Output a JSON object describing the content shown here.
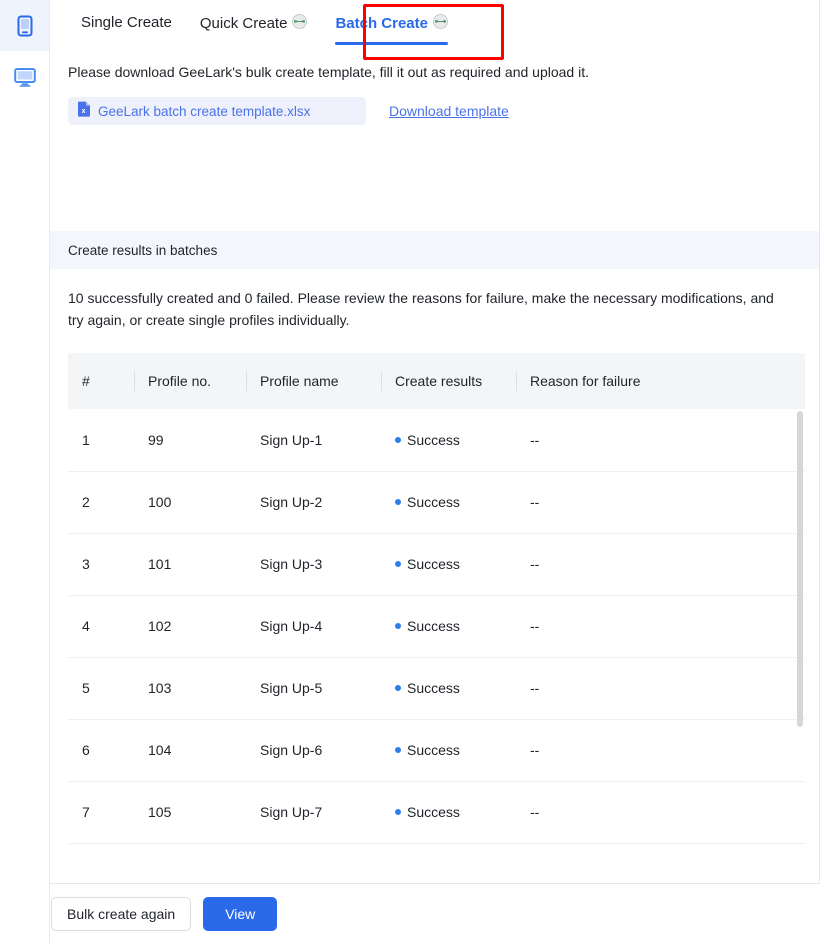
{
  "sidebar": {
    "items": [
      {
        "name": "phone-profiles",
        "icon": "phone-icon",
        "active": true
      },
      {
        "name": "desktop-profiles",
        "icon": "monitor-icon",
        "active": false
      }
    ]
  },
  "tabs": [
    {
      "label": "Single Create",
      "active": false,
      "has_help_badge": false
    },
    {
      "label": "Quick Create",
      "active": false,
      "has_help_badge": true
    },
    {
      "label": "Batch Create",
      "active": true,
      "has_help_badge": true
    }
  ],
  "highlight": {
    "color": "#fe0000",
    "target": "Batch Create"
  },
  "upload": {
    "instruction": "Please download GeeLark's bulk create template, fill it out as required and upload it.",
    "file_name": "GeeLark batch create template.xlsx",
    "file_icon": "xlsx-file-icon",
    "download_link": "Download template"
  },
  "results": {
    "band_title": "Create results in batches",
    "summary": "10 successfully created and 0 failed. Please review the reasons for failure, make the necessary modifications, and try again, or create single profiles individually.",
    "columns": [
      "#",
      "Profile no.",
      "Profile name",
      "Create results",
      "Reason for failure"
    ],
    "rows": [
      {
        "index": "1",
        "profile_no": "99",
        "profile_name": "Sign Up-1",
        "result": "Success",
        "reason": "--"
      },
      {
        "index": "2",
        "profile_no": "100",
        "profile_name": "Sign Up-2",
        "result": "Success",
        "reason": "--"
      },
      {
        "index": "3",
        "profile_no": "101",
        "profile_name": "Sign Up-3",
        "result": "Success",
        "reason": "--"
      },
      {
        "index": "4",
        "profile_no": "102",
        "profile_name": "Sign Up-4",
        "result": "Success",
        "reason": "--"
      },
      {
        "index": "5",
        "profile_no": "103",
        "profile_name": "Sign Up-5",
        "result": "Success",
        "reason": "--"
      },
      {
        "index": "6",
        "profile_no": "104",
        "profile_name": "Sign Up-6",
        "result": "Success",
        "reason": "--"
      },
      {
        "index": "7",
        "profile_no": "105",
        "profile_name": "Sign Up-7",
        "result": "Success",
        "reason": "--"
      }
    ]
  },
  "footer": {
    "secondary_label": "Bulk create again",
    "primary_label": "View"
  },
  "colors": {
    "accent": "#2a6ae9",
    "link": "#4a72e8",
    "status_success_dot": "#2f7ced",
    "band_bg": "#f4f6fd",
    "chip_bg": "#eef1fb",
    "highlight": "#fe0000"
  }
}
